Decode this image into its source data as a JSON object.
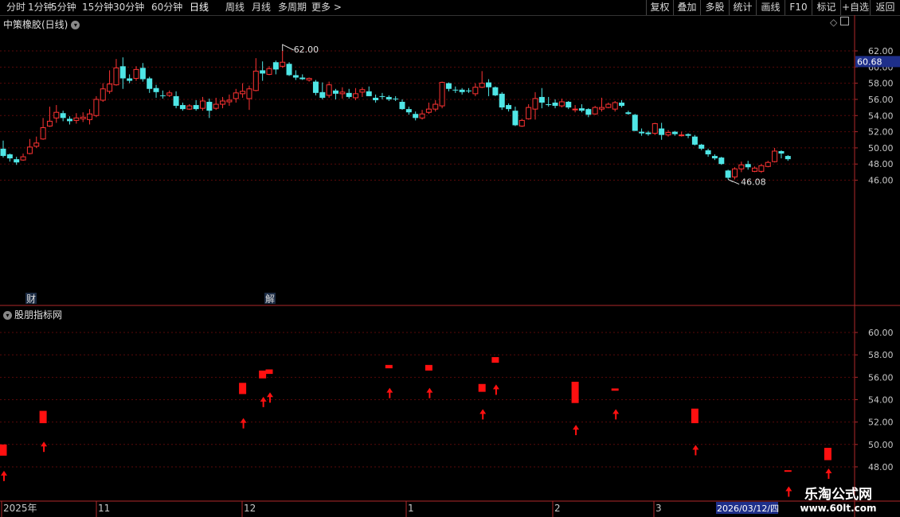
{
  "toolbar": {
    "periods": [
      "分时",
      "1分钟",
      "5分钟",
      "15分钟",
      "30分钟",
      "60分钟",
      "日线",
      "周线",
      "月线",
      "多周期",
      "更多 >"
    ],
    "active": "日线",
    "right_buttons": [
      "复权",
      "叠加",
      "多股",
      "统计",
      "画线",
      "F10",
      "标记",
      "+自选",
      "返回"
    ]
  },
  "main_chart": {
    "title": "中策橡胶(日线)",
    "axis_ticks": [
      "62.00",
      "60.00",
      "58.00",
      "56.00",
      "54.00",
      "52.00",
      "50.00",
      "48.00",
      "46.00"
    ],
    "current_price": "60.68",
    "high_label": "62.00",
    "low_label": "46.08",
    "event_markers": [
      "财",
      "解"
    ]
  },
  "indicator": {
    "title": "股朋指标网",
    "axis_ticks": [
      "60.00",
      "58.00",
      "56.00",
      "54.00",
      "52.00",
      "50.00",
      "48.00"
    ]
  },
  "time_axis": {
    "labels": [
      "2025年",
      "11",
      "12",
      "1",
      "2",
      "3"
    ],
    "cursor_date": "2026/03/12/四"
  },
  "watermark": {
    "line1": "乐淘公式网",
    "line2": "www.60lt.com"
  },
  "colors": {
    "up": "#ff3333",
    "down": "#4fe6e6",
    "signal": "#ff1010",
    "axis": "#b0282a",
    "grid": "#5a0a0a"
  },
  "chart_data": {
    "type": "candlestick",
    "y_range": [
      45.5,
      62.8
    ],
    "candles": [
      [
        49.9,
        49.0,
        50.9,
        48.8
      ],
      [
        49.2,
        48.7,
        49.3,
        48.3
      ],
      [
        48.6,
        48.2,
        48.9,
        47.9
      ],
      [
        48.5,
        48.9,
        49.3,
        48.4
      ],
      [
        49.3,
        50.1,
        51.1,
        49.2
      ],
      [
        50.2,
        50.6,
        51.4,
        50.0
      ],
      [
        51.1,
        52.5,
        53.7,
        51.0
      ],
      [
        52.7,
        53.3,
        55.1,
        52.6
      ],
      [
        53.7,
        54.4,
        55.3,
        53.1
      ],
      [
        54.3,
        53.7,
        54.6,
        53.3
      ],
      [
        53.6,
        53.3,
        53.9,
        52.9
      ],
      [
        53.4,
        53.7,
        54.3,
        53.0
      ],
      [
        53.6,
        53.8,
        54.4,
        53.2
      ],
      [
        53.5,
        54.2,
        54.8,
        52.9
      ],
      [
        54.0,
        56.0,
        56.4,
        53.8
      ],
      [
        55.9,
        57.3,
        58.0,
        55.7
      ],
      [
        57.0,
        57.9,
        59.6,
        56.7
      ],
      [
        57.8,
        59.9,
        61.0,
        57.7
      ],
      [
        60.1,
        58.6,
        61.2,
        57.3
      ],
      [
        58.6,
        58.3,
        59.1,
        58.0
      ],
      [
        58.6,
        59.7,
        60.1,
        58.3
      ],
      [
        59.9,
        58.5,
        60.5,
        58.2
      ],
      [
        58.6,
        57.3,
        58.8,
        56.8
      ],
      [
        57.4,
        56.9,
        57.8,
        56.2
      ],
      [
        56.5,
        56.4,
        57.1,
        56.1
      ],
      [
        56.5,
        56.8,
        57.1,
        56.3
      ],
      [
        56.4,
        55.2,
        57.0,
        54.9
      ],
      [
        55.3,
        54.8,
        55.6,
        54.6
      ],
      [
        54.8,
        55.2,
        55.4,
        54.7
      ],
      [
        55.3,
        54.8,
        55.9,
        54.6
      ],
      [
        54.9,
        55.8,
        56.3,
        54.6
      ],
      [
        55.7,
        54.6,
        56.1,
        53.7
      ],
      [
        54.9,
        55.4,
        56.2,
        54.7
      ],
      [
        55.4,
        55.8,
        56.3,
        54.9
      ],
      [
        55.7,
        55.9,
        56.6,
        55.2
      ],
      [
        56.1,
        56.8,
        57.3,
        55.6
      ],
      [
        56.7,
        57.0,
        58.0,
        56.2
      ],
      [
        56.1,
        57.3,
        57.7,
        54.7
      ],
      [
        57.1,
        59.5,
        61.1,
        57.0
      ],
      [
        59.6,
        59.2,
        60.7,
        58.3
      ],
      [
        59.1,
        59.8,
        60.1,
        59.0
      ],
      [
        60.6,
        59.7,
        60.8,
        59.1
      ],
      [
        60.1,
        60.6,
        62.0,
        59.9
      ],
      [
        60.4,
        59.0,
        60.6,
        58.9
      ],
      [
        59.0,
        58.7,
        59.6,
        58.4
      ],
      [
        58.7,
        58.5,
        59.1,
        58.4
      ],
      [
        58.4,
        58.6,
        58.7,
        58.2
      ],
      [
        58.2,
        56.8,
        58.4,
        56.5
      ],
      [
        56.9,
        56.2,
        58.1,
        56.0
      ],
      [
        56.5,
        57.8,
        58.2,
        56.2
      ],
      [
        57.1,
        56.7,
        57.3,
        56.0
      ],
      [
        56.7,
        56.9,
        57.5,
        56.1
      ],
      [
        56.8,
        56.3,
        57.3,
        56.1
      ],
      [
        56.2,
        56.7,
        57.4,
        55.9
      ],
      [
        56.9,
        57.2,
        57.5,
        56.3
      ],
      [
        57.0,
        56.4,
        57.6,
        56.4
      ],
      [
        56.2,
        55.9,
        56.6,
        55.6
      ],
      [
        56.4,
        56.3,
        56.8,
        56.0
      ],
      [
        56.3,
        56.0,
        56.5,
        55.8
      ],
      [
        56.1,
        56.0,
        56.4,
        55.8
      ],
      [
        55.7,
        54.8,
        56.0,
        54.7
      ],
      [
        54.8,
        54.4,
        55.1,
        54.1
      ],
      [
        54.2,
        53.7,
        54.5,
        53.4
      ],
      [
        53.7,
        54.2,
        54.7,
        53.5
      ],
      [
        54.4,
        54.8,
        55.6,
        54.2
      ],
      [
        54.8,
        55.4,
        55.9,
        54.5
      ],
      [
        55.2,
        58.1,
        58.2,
        54.9
      ],
      [
        58.0,
        57.3,
        58.1,
        57.0
      ],
      [
        57.2,
        57.1,
        57.6,
        56.8
      ],
      [
        57.2,
        56.9,
        57.4,
        56.6
      ],
      [
        57.1,
        57.0,
        57.4,
        56.8
      ],
      [
        56.7,
        57.5,
        58.0,
        56.4
      ],
      [
        57.5,
        58.0,
        59.5,
        57.4
      ],
      [
        58.1,
        57.5,
        58.5,
        56.4
      ],
      [
        57.5,
        56.5,
        57.6,
        56.4
      ],
      [
        56.7,
        55.0,
        56.9,
        54.7
      ],
      [
        55.3,
        54.8,
        55.5,
        54.5
      ],
      [
        54.6,
        52.8,
        55.1,
        52.7
      ],
      [
        52.7,
        53.4,
        53.6,
        52.6
      ],
      [
        53.6,
        55.0,
        55.4,
        53.5
      ],
      [
        54.8,
        56.1,
        56.9,
        53.5
      ],
      [
        56.3,
        55.6,
        57.4,
        54.9
      ],
      [
        55.4,
        55.3,
        56.3,
        55.1
      ],
      [
        55.6,
        55.2,
        56.0,
        54.9
      ],
      [
        55.2,
        55.7,
        56.1,
        55.0
      ],
      [
        55.7,
        55.0,
        55.8,
        54.8
      ],
      [
        54.8,
        54.8,
        55.3,
        54.4
      ],
      [
        54.9,
        54.6,
        55.4,
        54.4
      ],
      [
        54.8,
        54.1,
        54.9,
        53.8
      ],
      [
        54.2,
        55.0,
        55.2,
        54.1
      ],
      [
        54.8,
        55.0,
        56.2,
        54.5
      ],
      [
        55.0,
        55.4,
        55.6,
        54.9
      ],
      [
        54.8,
        55.6,
        55.8,
        54.5
      ],
      [
        55.6,
        55.2,
        55.9,
        55.0
      ],
      [
        54.4,
        54.2,
        54.6,
        54.1
      ],
      [
        54.1,
        52.1,
        54.2,
        52.1
      ],
      [
        52.0,
        51.8,
        52.4,
        51.5
      ],
      [
        51.9,
        51.7,
        52.1,
        51.5
      ],
      [
        51.8,
        53.0,
        53.1,
        51.6
      ],
      [
        52.4,
        51.6,
        53.1,
        51.0
      ],
      [
        51.6,
        51.9,
        52.2,
        51.4
      ],
      [
        52.0,
        51.7,
        52.1,
        51.5
      ],
      [
        51.6,
        51.6,
        52.0,
        51.4
      ],
      [
        51.7,
        51.5,
        51.8,
        51.2
      ],
      [
        51.4,
        50.4,
        51.6,
        50.3
      ],
      [
        50.4,
        49.9,
        50.5,
        49.7
      ],
      [
        49.7,
        49.2,
        49.9,
        48.9
      ],
      [
        49.0,
        48.7,
        49.2,
        48.5
      ],
      [
        48.8,
        48.0,
        48.9,
        47.9
      ],
      [
        47.2,
        46.3,
        47.3,
        46.1
      ],
      [
        46.4,
        47.4,
        47.6,
        46.1
      ],
      [
        47.4,
        47.9,
        48.3,
        47.0
      ],
      [
        48.0,
        47.6,
        48.4,
        47.3
      ],
      [
        47.1,
        47.5,
        47.7,
        47.0
      ],
      [
        47.1,
        47.8,
        48.0,
        46.9
      ],
      [
        47.7,
        48.2,
        48.4,
        47.6
      ],
      [
        48.3,
        49.6,
        50.0,
        48.2
      ],
      [
        49.6,
        49.3,
        49.7,
        48.7
      ],
      [
        49.0,
        48.6,
        49.1,
        48.4
      ]
    ],
    "signal_bars": [
      {
        "i": 0,
        "top": 50.0,
        "bottom": 49.0,
        "arrow": 47.3
      },
      {
        "i": 6,
        "top": 53.0,
        "bottom": 51.9,
        "arrow": 49.9
      },
      {
        "i": 36,
        "top": 55.5,
        "bottom": 54.5,
        "arrow": 52.0
      },
      {
        "i": 39,
        "top": 56.6,
        "bottom": 55.9,
        "arrow": 53.9
      },
      {
        "i": 40,
        "top": 56.7,
        "bottom": 56.3,
        "arrow": 54.3
      },
      {
        "i": 58,
        "top": 57.1,
        "bottom": 56.8,
        "arrow": 54.7
      },
      {
        "i": 64,
        "top": 57.1,
        "bottom": 56.6,
        "arrow": 54.7
      },
      {
        "i": 72,
        "top": 55.4,
        "bottom": 54.7,
        "arrow": 52.8
      },
      {
        "i": 74,
        "top": 57.8,
        "bottom": 57.3,
        "arrow": 55.0
      },
      {
        "i": 86,
        "top": 55.6,
        "bottom": 53.7,
        "arrow": 51.4
      },
      {
        "i": 92,
        "top": 55.0,
        "bottom": 54.8,
        "arrow": 52.8
      },
      {
        "i": 104,
        "top": 53.2,
        "bottom": 51.9,
        "arrow": 49.6
      },
      {
        "i": 118,
        "top": 47.7,
        "bottom": 47.6,
        "arrow": 45.9
      },
      {
        "i": 124,
        "top": 49.7,
        "bottom": 48.6,
        "arrow": 47.5
      }
    ]
  }
}
